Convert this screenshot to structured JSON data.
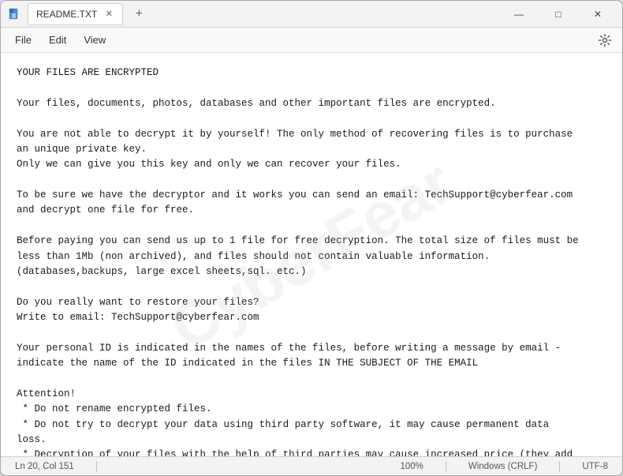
{
  "window": {
    "title": "README.TXT",
    "icon": "notepad"
  },
  "tabs": [
    {
      "label": "README.TXT",
      "active": true
    }
  ],
  "tab_new_label": "+",
  "window_controls": {
    "minimize": "—",
    "maximize": "□",
    "close": "✕"
  },
  "menu": {
    "items": [
      "File",
      "Edit",
      "View"
    ]
  },
  "content": "YOUR FILES ARE ENCRYPTED\n\nYour files, documents, photos, databases and other important files are encrypted.\n\nYou are not able to decrypt it by yourself! The only method of recovering files is to purchase\nan unique private key.\nOnly we can give you this key and only we can recover your files.\n\nTo be sure we have the decryptor and it works you can send an email: TechSupport@cyberfear.com\nand decrypt one file for free.\n\nBefore paying you can send us up to 1 file for free decryption. The total size of files must be\nless than 1Mb (non archived), and files should not contain valuable information.\n(databases,backups, large excel sheets,sql. etc.)\n\nDo you really want to restore your files?\nWrite to email: TechSupport@cyberfear.com\n\nYour personal ID is indicated in the names of the files, before writing a message by email -\nindicate the name of the ID indicated in the files IN THE SUBJECT OF THE EMAIL\n\nAttention!\n * Do not rename encrypted files.\n * Do not try to decrypt your data using third party software, it may cause permanent data\nloss.\n * Decryption of your files with the help of third parties may cause increased price (they add\ntheir fee to our) or you can become a victim of a scam.",
  "status_bar": {
    "position": "Ln 20, Col 151",
    "zoom": "100%",
    "line_ending": "Windows (CRLF)",
    "encoding": "UTF-8"
  }
}
